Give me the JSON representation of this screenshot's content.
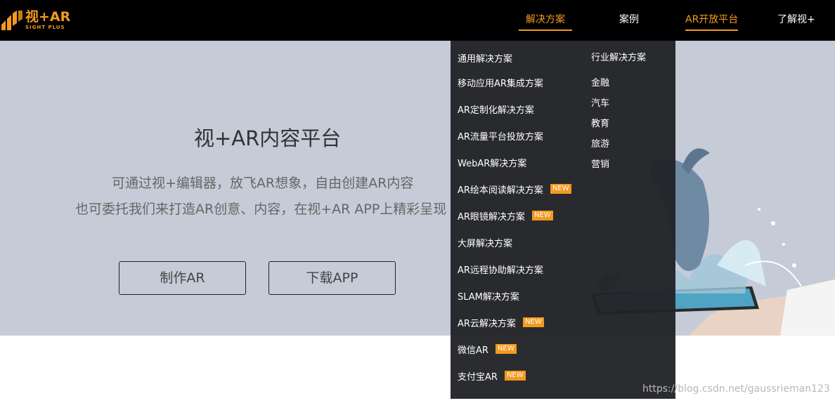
{
  "brand": {
    "name": "视+AR",
    "tagline": "SIGHT PLUS"
  },
  "nav": [
    {
      "label": "解决方案",
      "active": true
    },
    {
      "label": "案例",
      "active": false
    },
    {
      "label": "AR开放平台",
      "active": true
    },
    {
      "label": "了解视+",
      "active": false
    }
  ],
  "hero": {
    "title": "视+AR内容平台",
    "line1": "可通过视+编辑器，放飞AR想象，自由创建AR内容",
    "line2": "也可委托我们来打造AR创意、内容，在视+AR APP上精彩呈现",
    "btn_make": "制作AR",
    "btn_download": "下载APP"
  },
  "dropdown": {
    "general": [
      {
        "label": "通用解决方案",
        "badge": ""
      },
      {
        "label": "移动应用AR集成方案",
        "badge": ""
      },
      {
        "label": "AR定制化解决方案",
        "badge": ""
      },
      {
        "label": "AR流量平台投放方案",
        "badge": ""
      },
      {
        "label": "WebAR解决方案",
        "badge": ""
      },
      {
        "label": "AR绘本阅读解决方案",
        "badge": "NEW"
      },
      {
        "label": "AR眼镜解决方案",
        "badge": "NEW"
      },
      {
        "label": "大屏解决方案",
        "badge": ""
      },
      {
        "label": "AR远程协助解决方案",
        "badge": ""
      },
      {
        "label": "SLAM解决方案",
        "badge": ""
      },
      {
        "label": "AR云解决方案",
        "badge": "NEW"
      },
      {
        "label": "微信AR",
        "badge": "NEW"
      },
      {
        "label": "支付宝AR",
        "badge": "NEW"
      }
    ],
    "industry_title": "行业解决方案",
    "industry": [
      "金融",
      "汽车",
      "教育",
      "旅游",
      "营销"
    ]
  },
  "watermark": "https://blog.csdn.net/gaussrieman123",
  "colors": {
    "accent": "#f39a1e",
    "header_bg": "#000000",
    "hero_bg": "#c5cbd7",
    "dropdown_bg": "#222326"
  }
}
